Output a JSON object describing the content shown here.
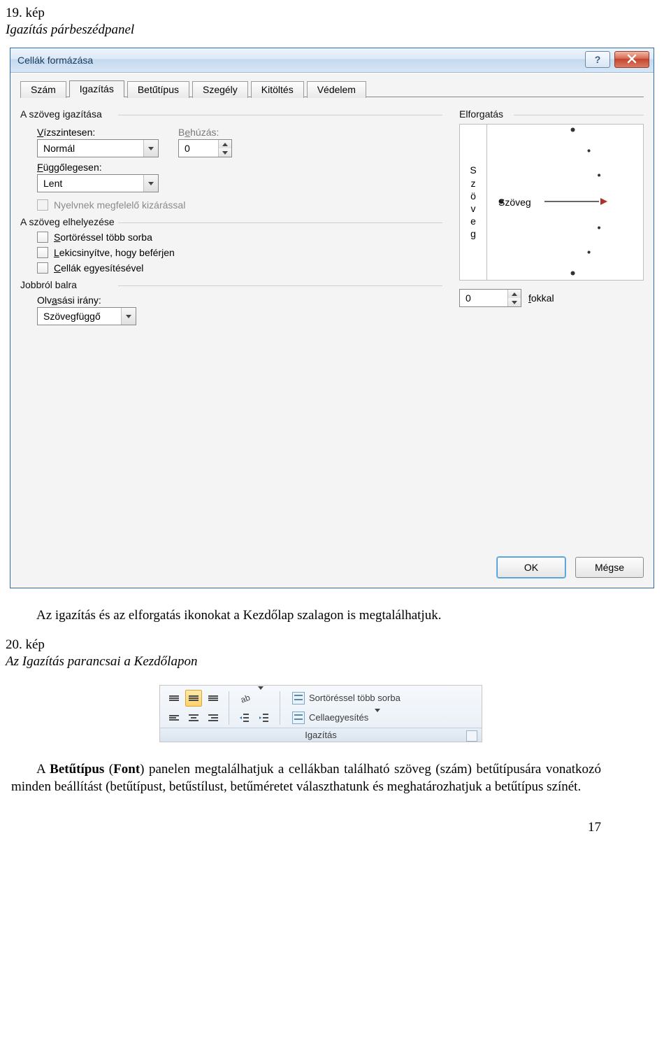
{
  "fig19": {
    "label": "19. kép",
    "caption": "Igazítás párbeszédpanel"
  },
  "dialog": {
    "title": "Cellák formázása",
    "tabs": [
      "Szám",
      "Igazítás",
      "Betűtípus",
      "Szegély",
      "Kitöltés",
      "Védelem"
    ],
    "active_tab": 1,
    "align": {
      "group": "A szöveg igazítása",
      "horiz_label": "Vízszintesen:",
      "horiz_value": "Normál",
      "indent_label": "Behúzás:",
      "indent_value": "0",
      "vert_label": "Függőlegesen:",
      "vert_value": "Lent",
      "lang_justify": "Nyelvnek megfelelő kizárással"
    },
    "placement": {
      "group": "A szöveg elhelyezése",
      "wrap": "Sortöréssel több sorba",
      "shrink": "Lekicsinyítve, hogy beférjen",
      "merge": "Cellák egyesítésével"
    },
    "rtl": {
      "group": "Jobbról balra",
      "dir_label": "Olvasási irány:",
      "dir_value": "Szövegfüggő"
    },
    "orient": {
      "group": "Elforgatás",
      "vertical_text": "Szöveg",
      "label_text": "Szöveg",
      "degrees": "0",
      "unit": "fokkal"
    },
    "ok": "OK",
    "cancel": "Mégse"
  },
  "mid_text": "Az igazítás és az elforgatás ikonokat a Kezdőlap szalagon is megtalálhatjuk.",
  "fig20": {
    "label": "20. kép",
    "caption": "Az Igazítás parancsai a Kezdőlapon"
  },
  "ribbon": {
    "wrap": "Sortöréssel több sorba",
    "merge": "Cellaegyesítés",
    "caption": "Igazítás"
  },
  "body": "A Betűtípus (Font) panelen megtalálhatjuk a cellákban található szöveg (szám) betűtípusára vonatkozó minden beállítást (betűtípust, betűstílust, betűméretet választhatunk és meghatározhatjuk a betűtípus színét.",
  "pagenum": "17"
}
